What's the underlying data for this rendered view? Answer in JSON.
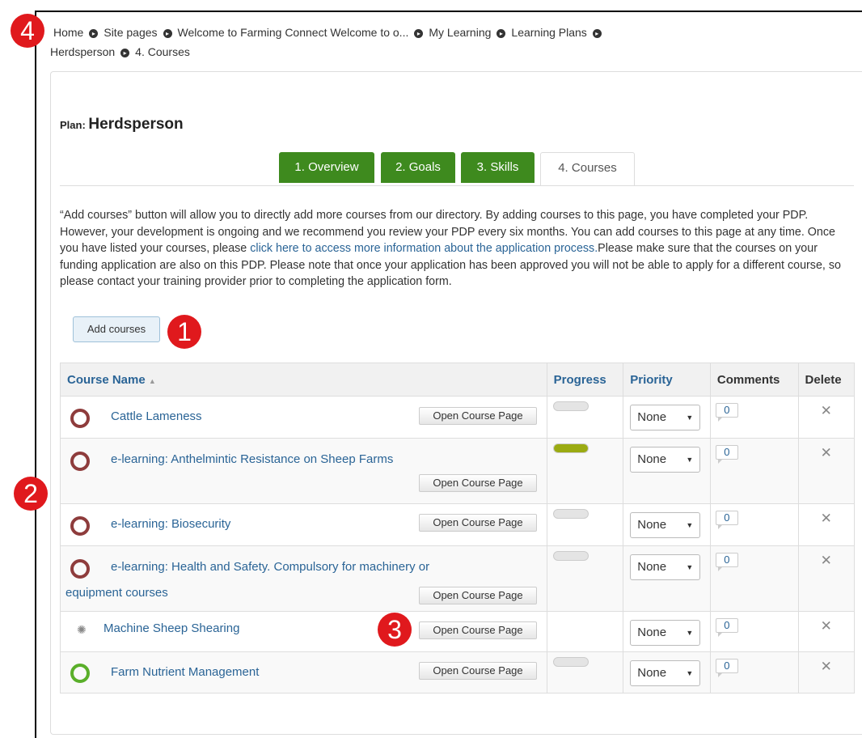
{
  "breadcrumb": {
    "items": [
      "Home",
      "Site pages",
      "Welcome to Farming Connect Welcome to o...",
      "My Learning",
      "Learning Plans",
      "Herdsperson",
      "4. Courses"
    ],
    "separator_icon": "chevron-circle-right-icon"
  },
  "plan": {
    "label": "Plan:",
    "name": "Herdsperson"
  },
  "tabs": [
    {
      "label": "1. Overview",
      "active": false
    },
    {
      "label": "2. Goals",
      "active": false
    },
    {
      "label": "3. Skills",
      "active": false
    },
    {
      "label": "4. Courses",
      "active": true
    }
  ],
  "intro": {
    "text_before": "“Add courses” button will allow you to directly add more courses from our directory. By adding courses to this page, you have completed your PDP. However, your development is ongoing and we recommend you review your PDP every six months. You can add courses to this page at any time. Once you have listed your courses, please ",
    "link": "click here to access more information about the application process.",
    "text_after": "Please make sure that the courses on your funding application are also on this PDP. Please note that once your application has been approved you will not be able to apply for a different course, so please contact your training provider prior to completing the application form."
  },
  "add_button": "Add courses",
  "table": {
    "headers": {
      "course": "Course Name",
      "progress": "Progress",
      "priority": "Priority",
      "comments": "Comments",
      "delete": "Delete"
    },
    "sort_icon": "sort-ascending-icon",
    "open_label": "Open Course Page",
    "rows": [
      {
        "name": "Cattle Lameness",
        "progress_pct": 0,
        "priority": "None",
        "comments": "0",
        "icon": "course-status-ring-red-icon"
      },
      {
        "name": "e-learning: Anthelmintic Resistance on Sheep Farms",
        "progress_pct": 100,
        "priority": "None",
        "comments": "0",
        "icon": "course-status-ring-red-icon"
      },
      {
        "name": "e-learning: Biosecurity",
        "progress_pct": 0,
        "priority": "None",
        "comments": "0",
        "icon": "course-status-ring-red-icon"
      },
      {
        "name": "e-learning: Health and Safety. Compulsory for machinery or",
        "name_cont": "equipment courses",
        "progress_pct": 0,
        "priority": "None",
        "comments": "0",
        "icon": "course-status-ring-red-icon"
      },
      {
        "name": "Machine Sheep Shearing",
        "progress_pct": null,
        "priority": "None",
        "comments": "0",
        "icon": "course-status-loading-icon"
      },
      {
        "name": "Farm Nutrient Management",
        "progress_pct": 0,
        "priority": "None",
        "comments": "0",
        "icon": "course-status-ring-green-icon"
      }
    ]
  },
  "annotations": [
    "4",
    "1",
    "2",
    "3"
  ],
  "colors": {
    "tab_green": "#3e8a1e",
    "link_blue": "#2a6496",
    "badge_red": "#e0191d",
    "progress_fill": "#9bab12"
  }
}
